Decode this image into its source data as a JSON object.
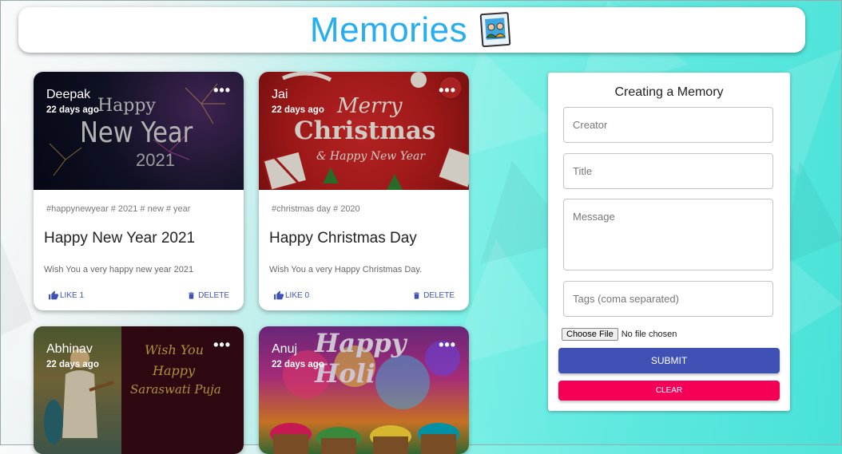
{
  "appbar": {
    "title": "Memories",
    "logo_icon": "photo-memories-icon"
  },
  "colors": {
    "title": "#27aef0",
    "primary": "#3f51b5",
    "secondary": "#f50057"
  },
  "posts": [
    {
      "creator": "Deepak",
      "time": "22 days ago",
      "tags": "#happynewyear # 2021 # new # year",
      "title": "Happy New Year 2021",
      "message": "Wish You a very happy new year 2021",
      "like_label": "LIKE 1",
      "delete_label": "DELETE",
      "image_text": [
        "Happy",
        "New Year",
        "2021"
      ]
    },
    {
      "creator": "Jai",
      "time": "22 days ago",
      "tags": "#christmas day # 2020",
      "title": "Happy Christmas Day",
      "message": "Wish You a very Happy Christmas Day.",
      "like_label": "LIKE 0",
      "delete_label": "DELETE",
      "image_text": [
        "Merry",
        "Christmas",
        "& Happy New Year"
      ]
    },
    {
      "creator": "Abhinav",
      "time": "22 days ago",
      "image_text": [
        "Wish You",
        "Happy",
        "Saraswati Puja"
      ]
    },
    {
      "creator": "Anuj",
      "time": "22 days ago",
      "image_text": [
        "Happy Holi"
      ]
    }
  ],
  "form": {
    "title": "Creating a Memory",
    "creator_placeholder": "Creator",
    "title_placeholder": "Title",
    "message_placeholder": "Message",
    "tags_placeholder": "Tags (coma separated)",
    "file_button": "Choose File",
    "file_status": "No file chosen",
    "submit_label": "SUBMIT",
    "clear_label": "CLEAR"
  }
}
